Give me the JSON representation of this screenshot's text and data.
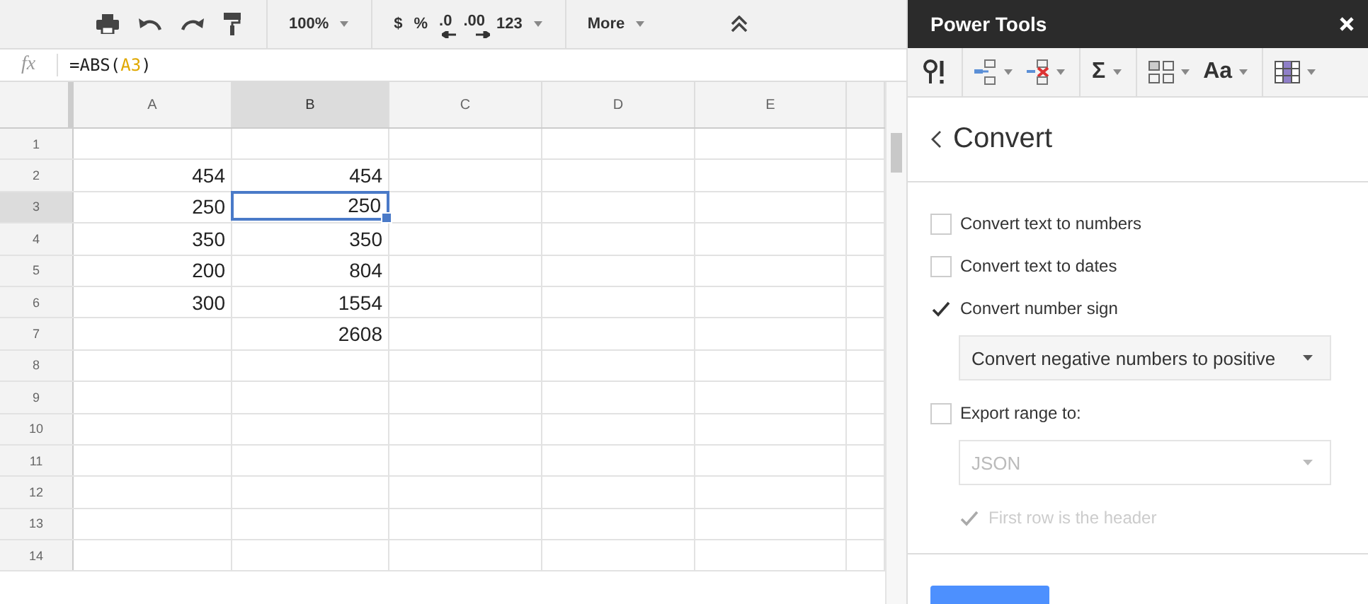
{
  "toolbar": {
    "items": [
      {
        "kind": "icon"
      },
      {
        "kind": "icon"
      },
      {
        "kind": "icon"
      },
      {
        "kind": "icon"
      },
      {
        "kind": "sep"
      },
      {
        "kind": "dropdown",
        "label": "100%"
      },
      {
        "kind": "sep"
      },
      {
        "kind": "text",
        "label": "$"
      },
      {
        "kind": "text",
        "label": "%"
      },
      {
        "kind": "decimal",
        "label": ".0"
      },
      {
        "kind": "decimal",
        "label": ".00"
      },
      {
        "kind": "dropdown",
        "label": "123"
      },
      {
        "kind": "sep"
      },
      {
        "kind": "dropdown",
        "label": "More"
      }
    ]
  },
  "formula_bar": {
    "label": "fx",
    "parts": [
      {
        "text": "=ABS(",
        "kind": "plain"
      },
      {
        "text": "A3",
        "kind": "ref"
      },
      {
        "text": ")",
        "kind": "plain"
      }
    ]
  },
  "sheet": {
    "columns": [
      {
        "label": "A",
        "selected": false
      },
      {
        "label": "B",
        "selected": true
      },
      {
        "label": "C",
        "selected": false
      },
      {
        "label": "D",
        "selected": false
      },
      {
        "label": "E",
        "selected": false
      }
    ],
    "rows": [
      {
        "label": "1",
        "selected": false,
        "cells": []
      },
      {
        "label": "2",
        "selected": false,
        "cells": [
          {
            "text": "454",
            "selected": false
          },
          {
            "text": "454",
            "selected": false
          }
        ]
      },
      {
        "label": "3",
        "selected": true,
        "cells": [
          {
            "text": "250",
            "selected": false
          },
          {
            "text": "250",
            "selected": true
          }
        ]
      },
      {
        "label": "4",
        "selected": false,
        "cells": [
          {
            "text": "350",
            "selected": false
          },
          {
            "text": "350",
            "selected": false
          }
        ]
      },
      {
        "label": "5",
        "selected": false,
        "cells": [
          {
            "text": "200",
            "selected": false
          },
          {
            "text": "804",
            "selected": false
          }
        ]
      },
      {
        "label": "6",
        "selected": false,
        "cells": [
          {
            "text": "300",
            "selected": false
          },
          {
            "text": "1554",
            "selected": false
          }
        ]
      },
      {
        "label": "7",
        "selected": false,
        "cells": [
          null,
          {
            "text": "2608",
            "selected": false
          }
        ]
      },
      {
        "label": "8",
        "selected": false,
        "cells": []
      },
      {
        "label": "9",
        "selected": false,
        "cells": []
      },
      {
        "label": "10",
        "selected": false,
        "cells": []
      },
      {
        "label": "11",
        "selected": false,
        "cells": []
      },
      {
        "label": "12",
        "selected": false,
        "cells": []
      },
      {
        "label": "13",
        "selected": false,
        "cells": []
      },
      {
        "label": "14",
        "selected": false,
        "cells": []
      }
    ]
  },
  "sidebar": {
    "title": "Power Tools",
    "toolbar": [
      {
        "kind": "icon"
      },
      {
        "kind": "sep"
      },
      {
        "kind": "icon"
      },
      {
        "kind": "icon"
      },
      {
        "kind": "sep"
      },
      {
        "kind": "text",
        "label": "Σ"
      },
      {
        "kind": "sep"
      },
      {
        "kind": "icon"
      },
      {
        "kind": "text",
        "label": "Aa"
      },
      {
        "kind": "sep"
      },
      {
        "kind": "icon"
      }
    ],
    "back_label": "Convert",
    "options": [
      {
        "kind": "checkbox",
        "label": "Convert text to numbers",
        "checked": false,
        "disabled": false
      },
      {
        "kind": "checkbox",
        "label": "Convert text to dates",
        "checked": false,
        "disabled": false
      },
      {
        "kind": "checkbox",
        "label": "Convert number sign",
        "checked": true,
        "disabled": false
      },
      {
        "kind": "select",
        "value": "Convert negative numbers to positive",
        "disabled": false
      },
      {
        "kind": "checkbox",
        "label": "Export range to:",
        "checked": false,
        "disabled": false
      },
      {
        "kind": "select",
        "value": "JSON",
        "disabled": true
      },
      {
        "kind": "sub_checkbox",
        "label": "First row is the header",
        "checked": true,
        "disabled": true
      }
    ]
  }
}
